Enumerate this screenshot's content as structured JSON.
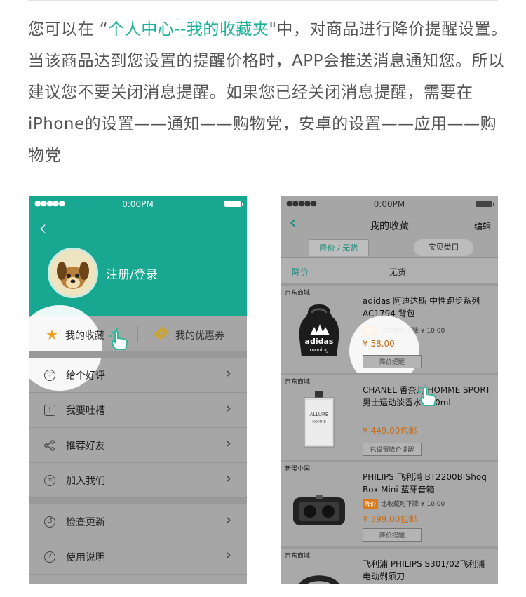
{
  "intro": {
    "text_before": "您可以在 “",
    "highlight": "个人中心--我的收藏夹",
    "text_after": "\"中，对商品进行降价提醒设置。当该商品达到您设置的提醒价格时，APP会推送消息通知您。所以建议您不要关闭消息提醒。如果您已经关闭消息提醒，需要在iPhone的设置——通知——购物党，安卓的设置——应用——购物党"
  },
  "left_phone": {
    "status": {
      "dots": "●●●●●",
      "time": "0:00PM"
    },
    "login": "注册/登录",
    "tabs": [
      {
        "label": "我的收藏",
        "icon": "star-icon"
      },
      {
        "label": "我的优惠券",
        "icon": "ticket-icon"
      }
    ],
    "menu": [
      {
        "label": "给个好评",
        "icon": "heart-chat-icon"
      },
      {
        "label": "我要吐槽",
        "icon": "chat-icon"
      },
      {
        "label": "推荐好友",
        "icon": "share-icon"
      },
      {
        "label": "加入我们",
        "icon": "handshake-icon"
      },
      {
        "label": "检查更新",
        "icon": "refresh-icon"
      },
      {
        "label": "使用说明",
        "icon": "help-icon"
      }
    ],
    "colors": {
      "header": "#18a790",
      "accent_star": "#e8a21c",
      "ticket": "#c8a33a"
    }
  },
  "right_phone": {
    "status": {
      "dots": "●●●●●",
      "time": "0:00PM"
    },
    "title": "我的收藏",
    "edit": "编辑",
    "segments": [
      "降价 / 无货",
      "宝贝类目"
    ],
    "filters": [
      "降价",
      "无货"
    ],
    "items": [
      {
        "store": "京东商城",
        "name": "adidas 阿迪达斯 中性跑步系列 AC1794 背包",
        "badge": "降价",
        "drop_text": "比收藏时下降 ¥ 10.00",
        "price": "¥ 58.00",
        "button": "降价提醒"
      },
      {
        "store": "京东商城",
        "name": "CHANEL 香奈儿 HOMME SPORT 男士运动淡香水 100ml",
        "price": "¥ 449.00包邮",
        "button": "已设置降价提醒"
      },
      {
        "store": "新蛋中国",
        "name": "PHILIPS 飞利浦 BT2200B Shoq Box Mini 蓝牙音箱",
        "badge": "降价",
        "drop_text": "比收藏时下降 ¥ 10.00",
        "price": "¥ 399.00包邮",
        "button": "降价提醒"
      },
      {
        "store": "京东商城",
        "name": "飞利浦 PHILIPS S301/02飞利浦电动剃须刀"
      }
    ],
    "colors": {
      "accent": "#128a77",
      "price": "#c46a12",
      "badge": "#d97a1c"
    }
  }
}
